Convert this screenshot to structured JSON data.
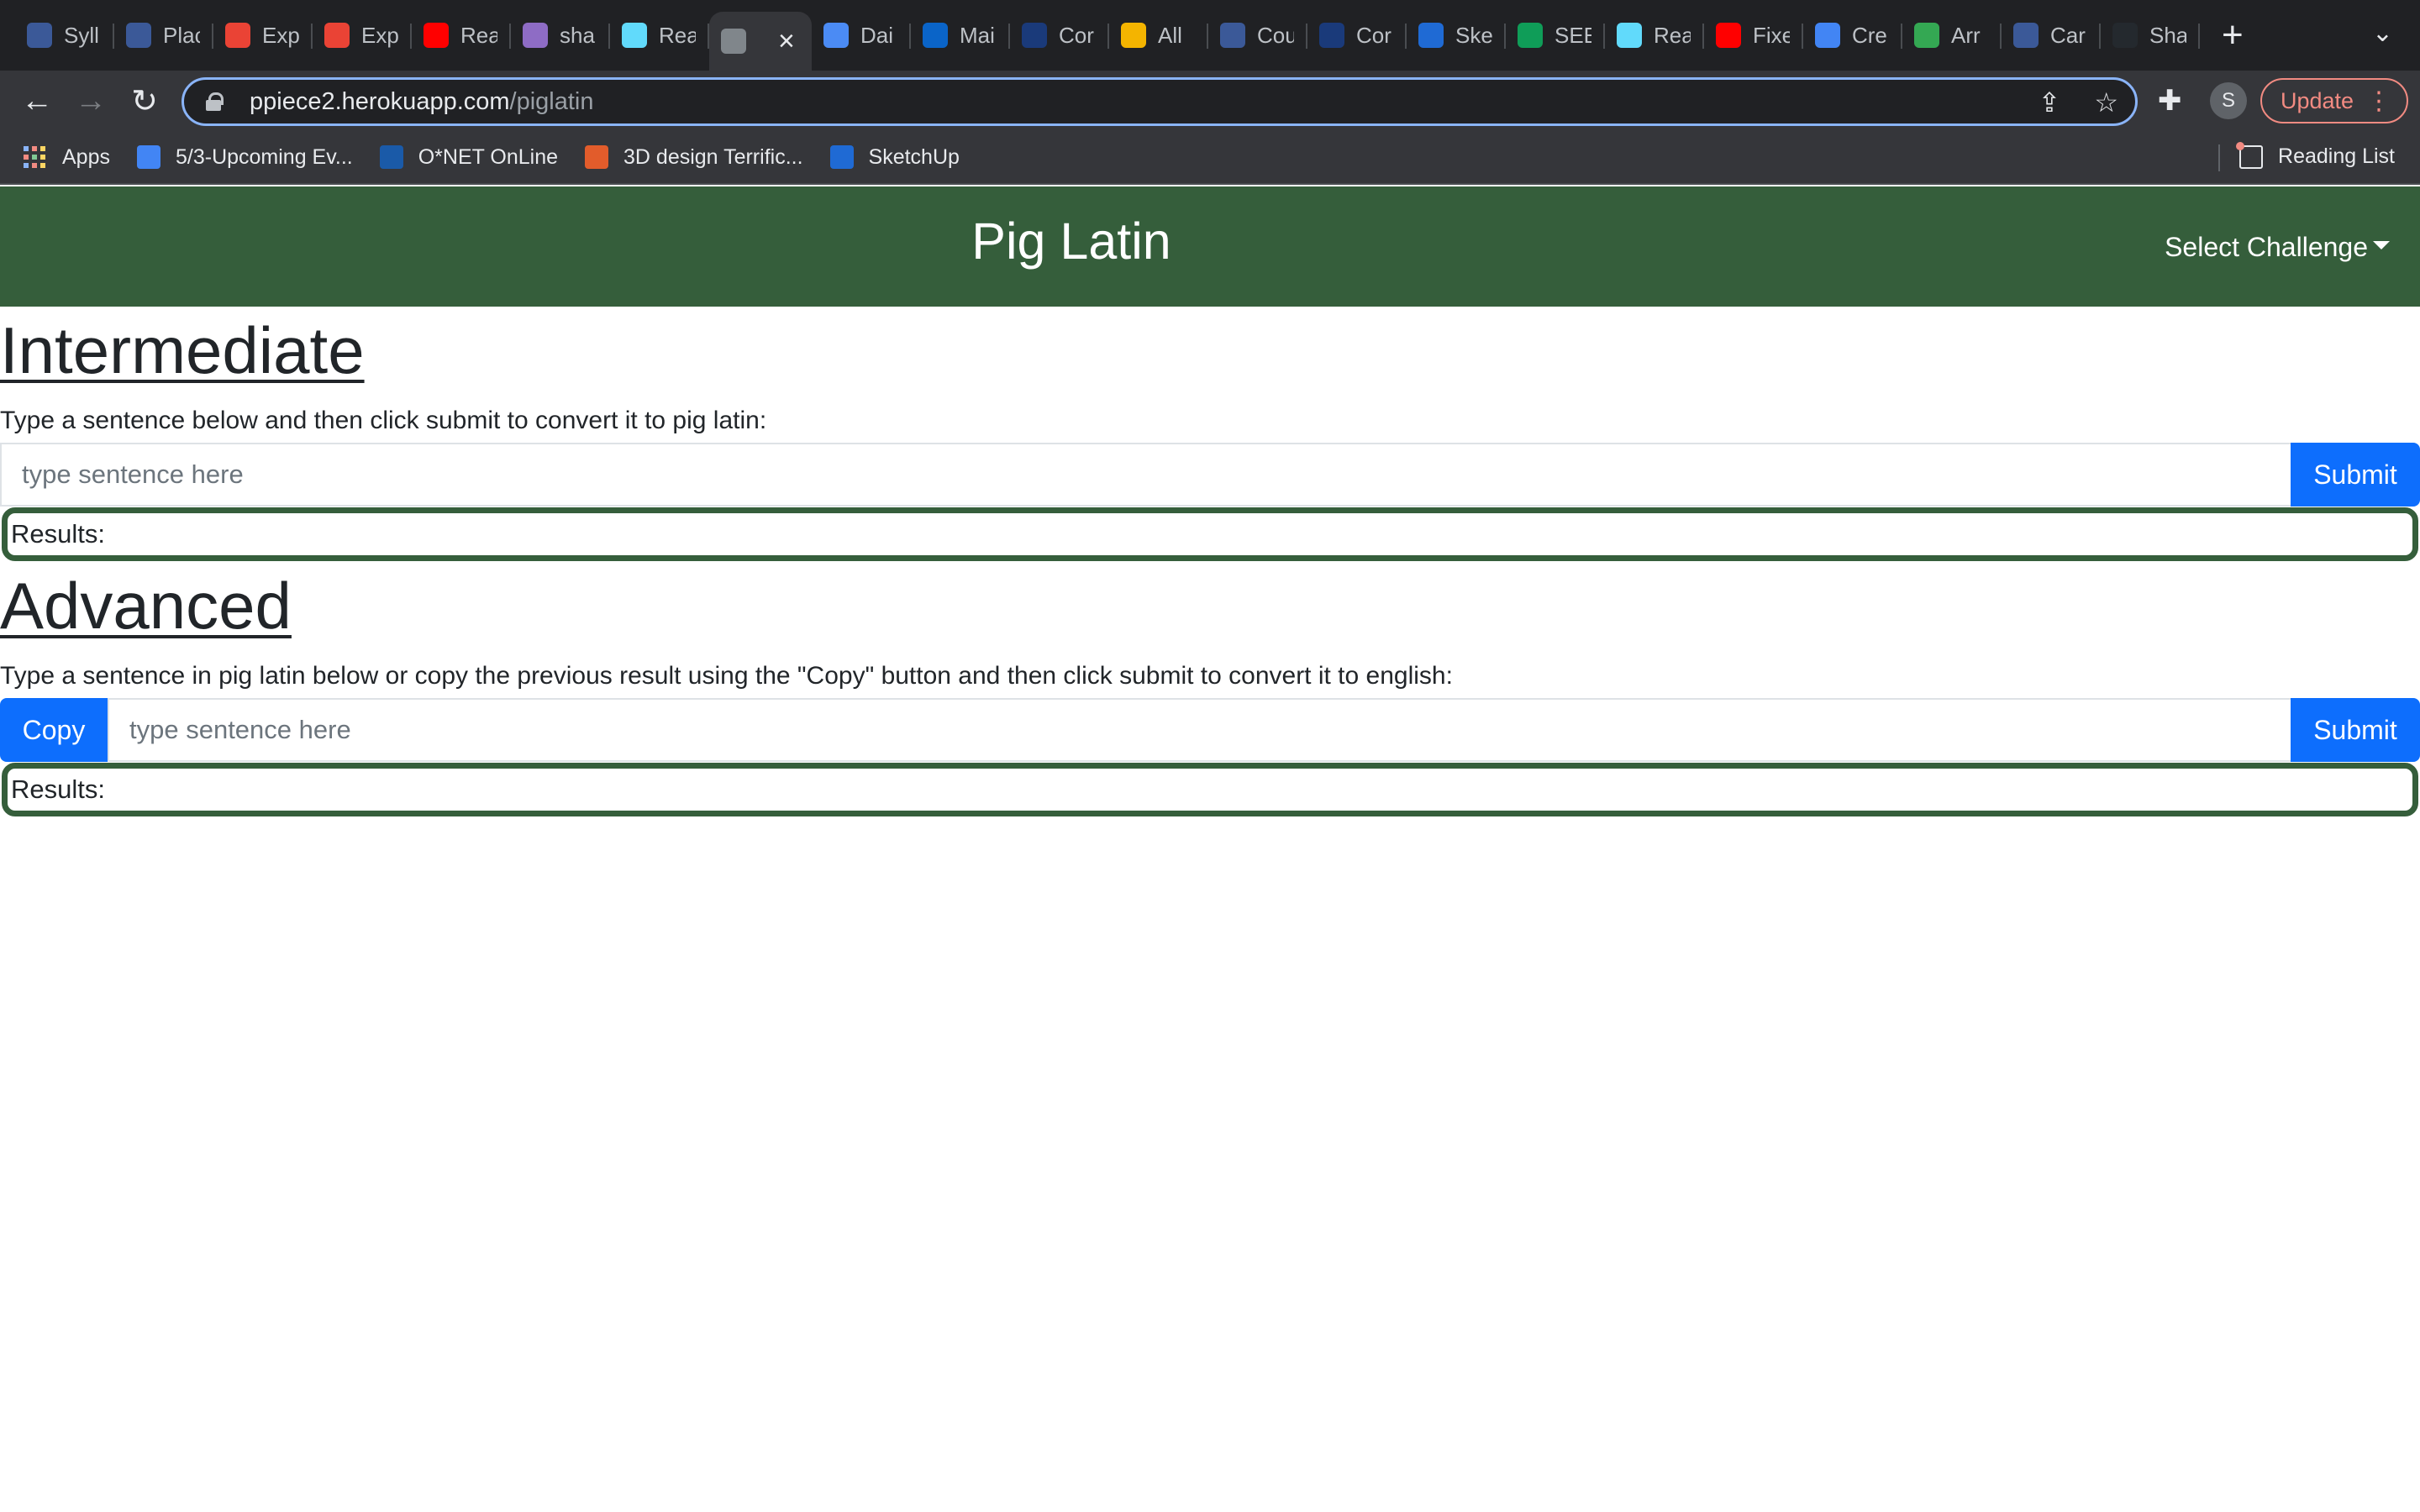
{
  "browser": {
    "tabs": [
      {
        "label": "Syll",
        "icon": "k-logo-icon",
        "color": "#3b5998"
      },
      {
        "label": "Plac",
        "icon": "k-logo-icon",
        "color": "#3b5998"
      },
      {
        "label": "Exp",
        "icon": "a-circle-icon",
        "color": "#ea4335"
      },
      {
        "label": "Exp",
        "icon": "a-circle-icon",
        "color": "#ea4335"
      },
      {
        "label": "Rea",
        "icon": "youtube-icon",
        "color": "#ff0000"
      },
      {
        "label": "sha",
        "icon": "h-logo-icon",
        "color": "#8e6cc5"
      },
      {
        "label": "Rea",
        "icon": "react-icon",
        "color": "#61dafb"
      },
      {
        "label": "",
        "icon": "globe-icon",
        "color": "#80868b"
      },
      {
        "label": "Dai",
        "icon": "checkmark-icon",
        "color": "#4b8bf4"
      },
      {
        "label": "Mai",
        "icon": "outlook-icon",
        "color": "#0a64c8"
      },
      {
        "label": "Cor",
        "icon": "blue-logo-icon",
        "color": "#1a3a7a"
      },
      {
        "label": "All",
        "icon": "s-logo-icon",
        "color": "#f4b400"
      },
      {
        "label": "Cou",
        "icon": "k-logo-icon",
        "color": "#3b5998"
      },
      {
        "label": "Cor",
        "icon": "blue-logo-icon",
        "color": "#1a3a7a"
      },
      {
        "label": "Ske",
        "icon": "sketchup-icon",
        "color": "#1f6ad4"
      },
      {
        "label": "SEE",
        "icon": "plus-square-icon",
        "color": "#0f9d58"
      },
      {
        "label": "Rea",
        "icon": "react-icon",
        "color": "#61dafb"
      },
      {
        "label": "Fixe",
        "icon": "youtube-icon",
        "color": "#ff0000"
      },
      {
        "label": "Cre",
        "icon": "c-circle-icon",
        "color": "#4285f4"
      },
      {
        "label": "Arr",
        "icon": "green-square-icon",
        "color": "#34a853"
      },
      {
        "label": "Car",
        "icon": "k-logo-icon",
        "color": "#3b5998"
      },
      {
        "label": "Sha",
        "icon": "github-icon",
        "color": "#24292e"
      }
    ],
    "active_tab_close": "×",
    "new_tab": "+",
    "tab_menu": "⌄",
    "url_host": "ppiece2.herokuapp.com",
    "url_path": "/piglatin",
    "avatar_letter": "S",
    "update_label": "Update",
    "bookmarks": [
      {
        "label": "Apps",
        "icon": "apps-grid-icon"
      },
      {
        "label": "5/3-Upcoming Ev...",
        "icon": "docs-icon",
        "color": "#4285f4"
      },
      {
        "label": "O*NET OnLine",
        "icon": "onet-icon",
        "color": "#1a5aa8"
      },
      {
        "label": "3D design Terrific...",
        "icon": "tinkercad-icon",
        "color": "#e25c2b"
      },
      {
        "label": "SketchUp",
        "icon": "sketchup-icon",
        "color": "#1f6ad4"
      }
    ],
    "reading_list": "Reading List"
  },
  "page": {
    "title": "Pig Latin",
    "select_challenge": "Select Challenge",
    "colors": {
      "brand": "#355e3b",
      "primary": "#0d6efd"
    },
    "intermediate": {
      "heading": "Intermediate",
      "prompt": "Type a sentence below and then click submit to convert it to pig latin:",
      "placeholder": "type sentence here",
      "submit": "Submit",
      "results": "Results:"
    },
    "advanced": {
      "heading": "Advanced",
      "prompt": "Type a sentence in pig latin below or copy the previous result using the \"Copy\" button and then click submit to convert it to english:",
      "copy": "Copy",
      "placeholder": "type sentence here",
      "submit": "Submit",
      "results": "Results:"
    }
  }
}
